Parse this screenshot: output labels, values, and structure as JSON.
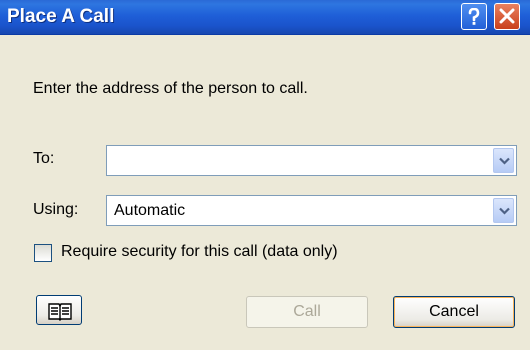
{
  "window": {
    "title": "Place A Call",
    "help_icon": "help-icon",
    "close_icon": "close-icon"
  },
  "instruction": "Enter the address of the person to call.",
  "to": {
    "label": "To:",
    "value": "",
    "dropdown_icon": "chevron-down-icon"
  },
  "using": {
    "label": "Using:",
    "value": "Automatic",
    "dropdown_icon": "chevron-down-icon"
  },
  "security": {
    "label": "Require security for this call (data only)",
    "checked": false
  },
  "buttons": {
    "address_book_icon": "address-book-icon",
    "call_label": "Call",
    "call_enabled": false,
    "cancel_label": "Cancel"
  },
  "colors": {
    "titlebar": "#1f5fd8",
    "dialog_bg": "#ece9d8",
    "close_button": "#c9401b",
    "disabled_text": "#aca899"
  }
}
